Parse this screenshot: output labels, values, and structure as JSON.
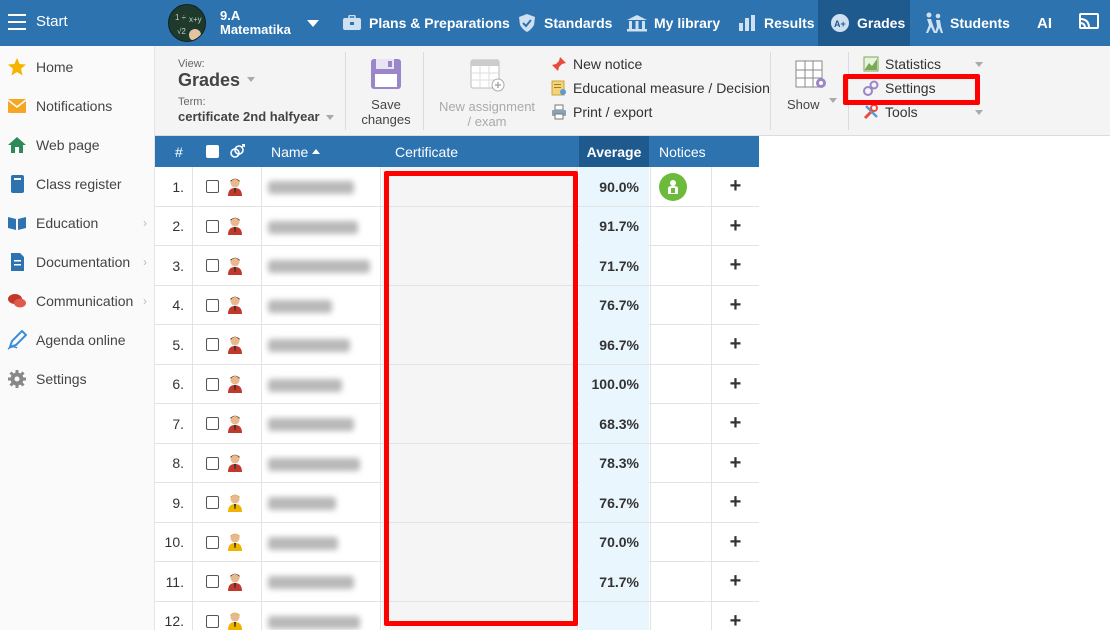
{
  "topbar": {
    "start_label": "Start",
    "class_name": "9.A",
    "class_subject": "Matematika",
    "menu": [
      {
        "label": "Plans & Preparations",
        "icon": "briefcase-icon"
      },
      {
        "label": "Standards",
        "icon": "shield-check-icon"
      },
      {
        "label": "My library",
        "icon": "library-icon"
      },
      {
        "label": "Results",
        "icon": "bar-chart-icon"
      },
      {
        "label": "Grades",
        "icon": "grades-icon"
      },
      {
        "label": "Students",
        "icon": "students-walking-icon"
      },
      {
        "label": "AI",
        "icon": ""
      }
    ],
    "colors": {
      "bar": "#2d73b0",
      "active": "#1e5a8e"
    }
  },
  "sidebar": {
    "items": [
      {
        "label": "Home",
        "icon": "star-icon",
        "has_submenu": false
      },
      {
        "label": "Notifications",
        "icon": "envelope-icon",
        "has_submenu": false
      },
      {
        "label": "Web page",
        "icon": "house-icon",
        "has_submenu": false
      },
      {
        "label": "Class register",
        "icon": "book-icon",
        "has_submenu": false
      },
      {
        "label": "Education",
        "icon": "open-book-icon",
        "has_submenu": true
      },
      {
        "label": "Documentation",
        "icon": "document-icon",
        "has_submenu": true
      },
      {
        "label": "Communication",
        "icon": "chat-bubbles-icon",
        "has_submenu": true
      },
      {
        "label": "Agenda online",
        "icon": "pen-icon",
        "has_submenu": false
      },
      {
        "label": "Settings",
        "icon": "gear-icon",
        "has_submenu": false
      }
    ]
  },
  "toolbar": {
    "view_label": "View:",
    "view_value": "Grades",
    "term_label": "Term:",
    "term_value": "certificate 2nd halfyear",
    "save_label_1": "Save",
    "save_label_2": "changes",
    "new_assignment_1": "New assignment",
    "new_assignment_2": "/ exam",
    "new_notice": "New notice",
    "educational_measure": "Educational measure / Decision",
    "print_export": "Print / export",
    "show": "Show",
    "statistics": "Statistics",
    "settings": "Settings",
    "tools": "Tools"
  },
  "table": {
    "headers": {
      "num": "#",
      "name": "Name",
      "certificate": "Certificate",
      "average": "Average",
      "notices": "Notices"
    },
    "rows": [
      {
        "num": "1.",
        "average": "90.0%",
        "notice": true,
        "gender": "male",
        "name_w": 86
      },
      {
        "num": "2.",
        "average": "91.7%",
        "notice": false,
        "gender": "male",
        "name_w": 90
      },
      {
        "num": "3.",
        "average": "71.7%",
        "notice": false,
        "gender": "male",
        "name_w": 102
      },
      {
        "num": "4.",
        "average": "76.7%",
        "notice": false,
        "gender": "male",
        "name_w": 64
      },
      {
        "num": "5.",
        "average": "96.7%",
        "notice": false,
        "gender": "male",
        "name_w": 82
      },
      {
        "num": "6.",
        "average": "100.0%",
        "notice": false,
        "gender": "male",
        "name_w": 74
      },
      {
        "num": "7.",
        "average": "68.3%",
        "notice": false,
        "gender": "male",
        "name_w": 86
      },
      {
        "num": "8.",
        "average": "78.3%",
        "notice": false,
        "gender": "male",
        "name_w": 92
      },
      {
        "num": "9.",
        "average": "76.7%",
        "notice": false,
        "gender": "female",
        "name_w": 68
      },
      {
        "num": "10.",
        "average": "70.0%",
        "notice": false,
        "gender": "female",
        "name_w": 70
      },
      {
        "num": "11.",
        "average": "71.7%",
        "notice": false,
        "gender": "male",
        "name_w": 86
      },
      {
        "num": "12.",
        "average": "",
        "notice": false,
        "gender": "female",
        "name_w": 92
      }
    ],
    "plus_glyph": "+"
  }
}
